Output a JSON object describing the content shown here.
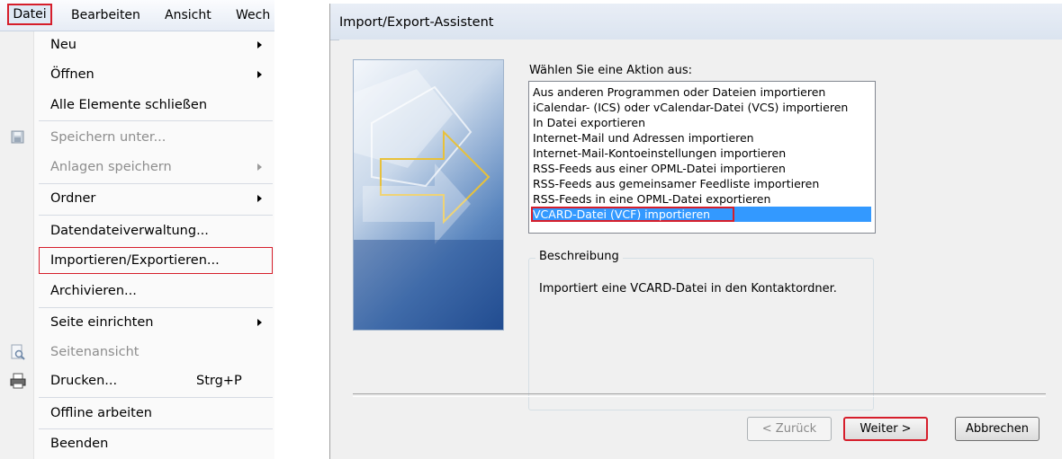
{
  "menubar": {
    "items": [
      "Datei",
      "Bearbeiten",
      "Ansicht",
      "Wech"
    ]
  },
  "file_menu": {
    "items": [
      {
        "label": "Neu"
      },
      {
        "label": "Öffnen"
      },
      {
        "label": "Alle Elemente schließen"
      },
      {
        "label": "Speichern unter..."
      },
      {
        "label": "Anlagen speichern"
      },
      {
        "label": "Ordner"
      },
      {
        "label": "Datendateiverwaltung..."
      },
      {
        "label": "Importieren/Exportieren..."
      },
      {
        "label": "Archivieren..."
      },
      {
        "label": "Seite einrichten"
      },
      {
        "label": "Seitenansicht"
      },
      {
        "label": "Drucken...",
        "shortcut": "Strg+P"
      },
      {
        "label": "Offline arbeiten"
      },
      {
        "label": "Beenden"
      }
    ]
  },
  "dialog": {
    "title": "Import/Export-Assistent",
    "prompt": "Wählen Sie eine Aktion aus:",
    "actions": [
      "Aus anderen Programmen oder Dateien importieren",
      "iCalendar- (ICS) oder vCalendar-Datei (VCS) importieren",
      "In Datei exportieren",
      "Internet-Mail und Adressen importieren",
      "Internet-Mail-Kontoeinstellungen importieren",
      "RSS-Feeds aus einer OPML-Datei importieren",
      "RSS-Feeds aus gemeinsamer Feedliste importieren",
      "RSS-Feeds in eine OPML-Datei exportieren",
      "VCARD-Datei (VCF) importieren"
    ],
    "description_label": "Beschreibung",
    "description_text": "Importiert eine VCARD-Datei in den Kontaktordner.",
    "buttons": {
      "back": "< Zurück",
      "next": "Weiter >",
      "cancel": "Abbrechen"
    }
  },
  "colors": {
    "highlight_frame": "#d61e2b",
    "selection": "#3399ff"
  }
}
